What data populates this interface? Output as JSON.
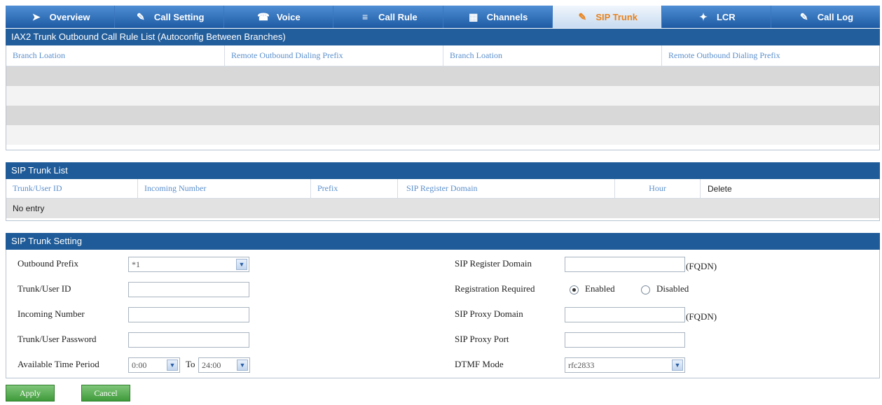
{
  "tabs": [
    {
      "label": "Overview",
      "icon": "overview-icon",
      "glyph": "➤"
    },
    {
      "label": "Call Setting",
      "icon": "call-setting-icon",
      "glyph": "✎"
    },
    {
      "label": "Voice",
      "icon": "voice-icon",
      "glyph": "☎"
    },
    {
      "label": "Call Rule",
      "icon": "call-rule-icon",
      "glyph": "≡"
    },
    {
      "label": "Channels",
      "icon": "channels-icon",
      "glyph": "▦"
    },
    {
      "label": "SIP Trunk",
      "icon": "sip-trunk-icon",
      "glyph": "✎",
      "active": true
    },
    {
      "label": "LCR",
      "icon": "lcr-icon",
      "glyph": "✦"
    },
    {
      "label": "Call Log",
      "icon": "call-log-icon",
      "glyph": "✎"
    }
  ],
  "iax": {
    "title": "IAX2 Trunk Outbound Call Rule List (Autoconfig Between Branches)",
    "headers": [
      "Branch Loation",
      "Remote Outbound Dialing Prefix",
      "Branch Loation",
      "Remote Outbound Dialing Prefix"
    ]
  },
  "trunk_list": {
    "title": "SIP Trunk List",
    "headers": [
      "Trunk/User ID",
      "Incoming Number",
      "Prefix",
      "SIP Register Domain",
      "Hour",
      "Delete"
    ],
    "empty_text": "No entry"
  },
  "settings": {
    "title": "SIP Trunk Setting",
    "outbound_prefix_label": "Outbound Prefix",
    "outbound_prefix_value": "*1",
    "trunk_user_id_label": "Trunk/User ID",
    "incoming_number_label": "Incoming Number",
    "trunk_user_password_label": "Trunk/User Password",
    "available_time_label": "Available Time Period",
    "time_from_value": "0:00",
    "time_to_label": "To",
    "time_to_value": "24:00",
    "register_domain_label": "SIP Register Domain",
    "fqdn_label": "(FQDN)",
    "registration_required_label": "Registration Required",
    "enabled_label": "Enabled",
    "disabled_label": "Disabled",
    "proxy_domain_label": "SIP Proxy Domain",
    "proxy_port_label": "SIP Proxy Port",
    "dtmf_label": "DTMF Mode",
    "dtmf_value": "rfc2833"
  },
  "buttons": {
    "apply": "Apply",
    "cancel": "Cancel"
  }
}
